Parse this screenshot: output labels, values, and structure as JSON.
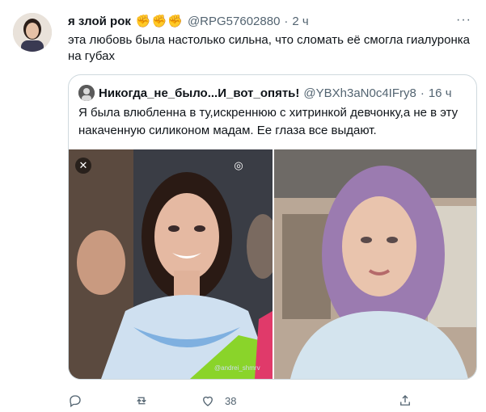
{
  "tweet": {
    "author_name": "я злой рок",
    "emojis": "✊✊✊",
    "handle": "@RPG57602880",
    "separator": "·",
    "time": "2 ч",
    "more": "···",
    "text": "эта любовь была настолько сильна, что сломать её смогла  гиалуронка на губах"
  },
  "quote": {
    "author_name": "Никогда_не_было...И_вот_опять!",
    "handle": "@YBXh3aN0c4IFry8",
    "separator": "·",
    "time": "16 ч",
    "text": "Я была влюбленна в ту,искреннюю с хитринкой девчонку,а не в эту накаченную силиконом мадам. Ее глаза все выдают.",
    "watermark": "@andrei_shmrv"
  },
  "actions": {
    "reply_count": "",
    "retweet_count": "",
    "like_count": "38"
  },
  "icons": {
    "close": "close-icon",
    "lens": "lens-icon",
    "reply": "reply-icon",
    "retweet": "retweet-icon",
    "like": "heart-icon",
    "share": "share-icon"
  },
  "colors": {
    "text": "#0f1419",
    "secondary": "#536471",
    "border": "#cfd9de",
    "emoji": "#f5b32b"
  }
}
